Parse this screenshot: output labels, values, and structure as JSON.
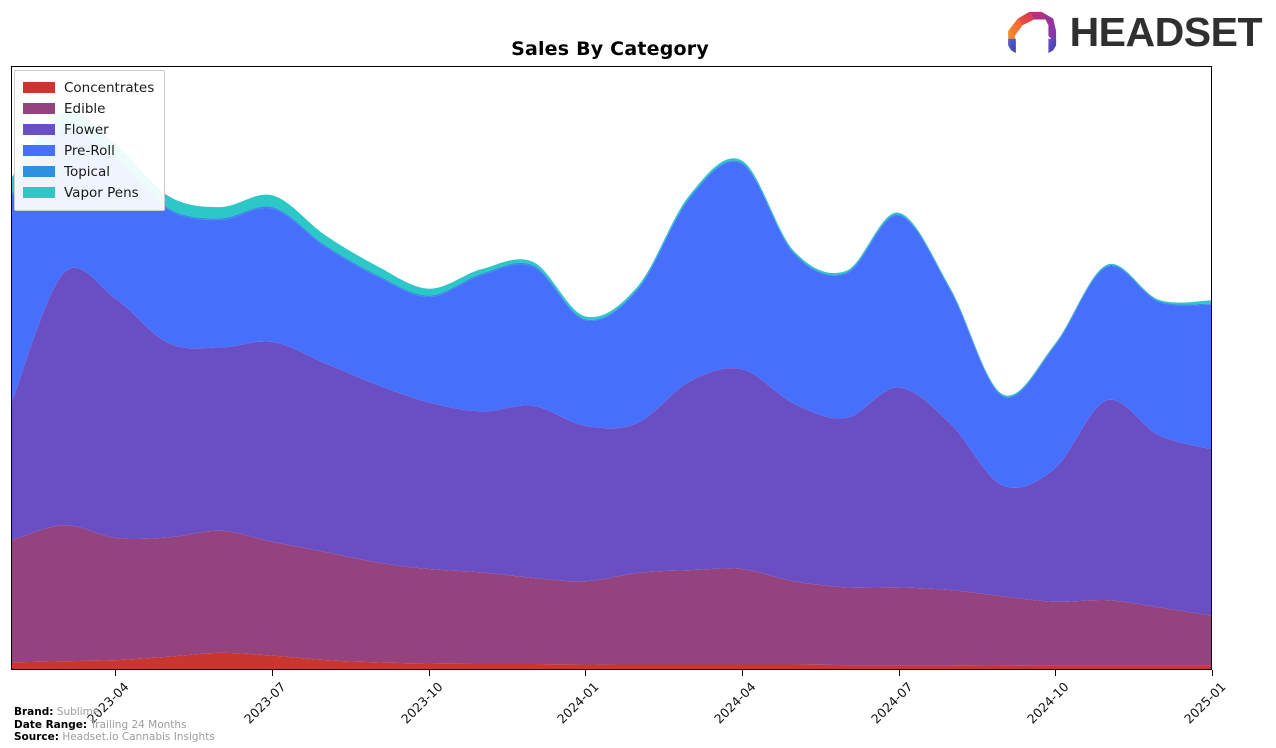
{
  "header": {
    "title": "Sales By Category",
    "logo_word": "HEADSET",
    "logo_icon": "headset-logo-icon"
  },
  "legend": {
    "position": "top-left",
    "items": [
      {
        "label": "Concentrates",
        "color": "#c8362f"
      },
      {
        "label": "Edible",
        "color": "#94437f"
      },
      {
        "label": "Flower",
        "color": "#6a4fc4"
      },
      {
        "label": "Pre-Roll",
        "color": "#4670fb"
      },
      {
        "label": "Topical",
        "color": "#2f8fe0"
      },
      {
        "label": "Vapor Pens",
        "color": "#2cc8c8"
      }
    ]
  },
  "footer": {
    "rows": [
      {
        "key": "Brand:",
        "value": "Sublime"
      },
      {
        "key": "Date Range:",
        "value": "Trailing 24 Months"
      },
      {
        "key": "Source:",
        "value": "Headset.io Cannabis Insights"
      }
    ]
  },
  "chart_data": {
    "type": "area",
    "stacked": true,
    "title": "Sales By Category",
    "xlabel": "",
    "ylabel": "",
    "grid": false,
    "legend_position": "top-left",
    "axis_tick_labels": [
      "2023-04",
      "2023-07",
      "2023-10",
      "2024-01",
      "2024-04",
      "2024-07",
      "2024-10",
      "2025-01"
    ],
    "axis_tick_positions_months": [
      2,
      5,
      8,
      11,
      14,
      17,
      20,
      23
    ],
    "x": [
      "2023-02",
      "2023-03",
      "2023-04",
      "2023-05",
      "2023-06",
      "2023-07",
      "2023-08",
      "2023-09",
      "2023-10",
      "2023-11",
      "2023-12",
      "2024-01",
      "2024-02",
      "2024-03",
      "2024-04",
      "2024-05",
      "2024-06",
      "2024-07",
      "2024-08",
      "2024-09",
      "2024-10",
      "2024-11",
      "2024-12",
      "2025-01"
    ],
    "ylim": [
      0,
      100
    ],
    "y_units": "relative sales index",
    "series": [
      {
        "name": "Concentrates",
        "color": "#c8362f",
        "values": [
          1.2,
          1.4,
          1.6,
          2.2,
          2.9,
          2.4,
          1.6,
          1.2,
          1.0,
          0.9,
          0.9,
          0.8,
          0.8,
          0.8,
          0.8,
          0.8,
          0.7,
          0.7,
          0.7,
          0.6,
          0.6,
          0.6,
          0.6,
          0.6
        ]
      },
      {
        "name": "Edible",
        "color": "#94437f",
        "values": [
          22.0,
          24.5,
          22.0,
          21.5,
          22.0,
          20.5,
          19.5,
          18.0,
          17.0,
          16.5,
          15.5,
          15.0,
          16.5,
          17.0,
          17.2,
          15.0,
          14.0,
          14.0,
          13.5,
          12.5,
          11.5,
          11.8,
          10.5,
          9.0
        ]
      },
      {
        "name": "Flower",
        "color": "#6a4fc4",
        "values": [
          25.0,
          45.5,
          43.0,
          35.0,
          33.0,
          36.0,
          34.0,
          32.0,
          30.0,
          29.0,
          31.0,
          28.0,
          27.0,
          34.0,
          36.0,
          32.0,
          30.5,
          36.0,
          30.0,
          20.0,
          24.0,
          36.0,
          31.0,
          30.0
        ]
      },
      {
        "name": "Pre-Roll",
        "color": "#4670fb",
        "values": [
          37.0,
          26.0,
          25.0,
          24.0,
          23.0,
          24.0,
          21.0,
          19.5,
          19.0,
          24.5,
          25.0,
          19.0,
          24.0,
          33.0,
          37.0,
          27.0,
          26.0,
          31.0,
          24.0,
          16.0,
          22.0,
          24.0,
          24.0,
          26.0
        ]
      },
      {
        "name": "Topical",
        "color": "#2f8fe0",
        "values": [
          0.4,
          0.4,
          0.4,
          0.3,
          0.3,
          0.3,
          0.3,
          0.3,
          0.3,
          0.3,
          0.3,
          0.2,
          0.2,
          0.2,
          0.2,
          0.2,
          0.2,
          0.2,
          0.2,
          0.2,
          0.2,
          0.2,
          0.2,
          0.2
        ]
      },
      {
        "name": "Vapor Pens",
        "color": "#2cc8c8",
        "values": [
          3.0,
          2.6,
          2.4,
          2.2,
          2.0,
          2.1,
          1.8,
          1.6,
          1.2,
          0.8,
          0.6,
          0.5,
          0.4,
          0.4,
          0.4,
          0.3,
          0.3,
          0.3,
          0.2,
          0.2,
          0.2,
          0.2,
          0.2,
          0.6
        ]
      }
    ]
  }
}
